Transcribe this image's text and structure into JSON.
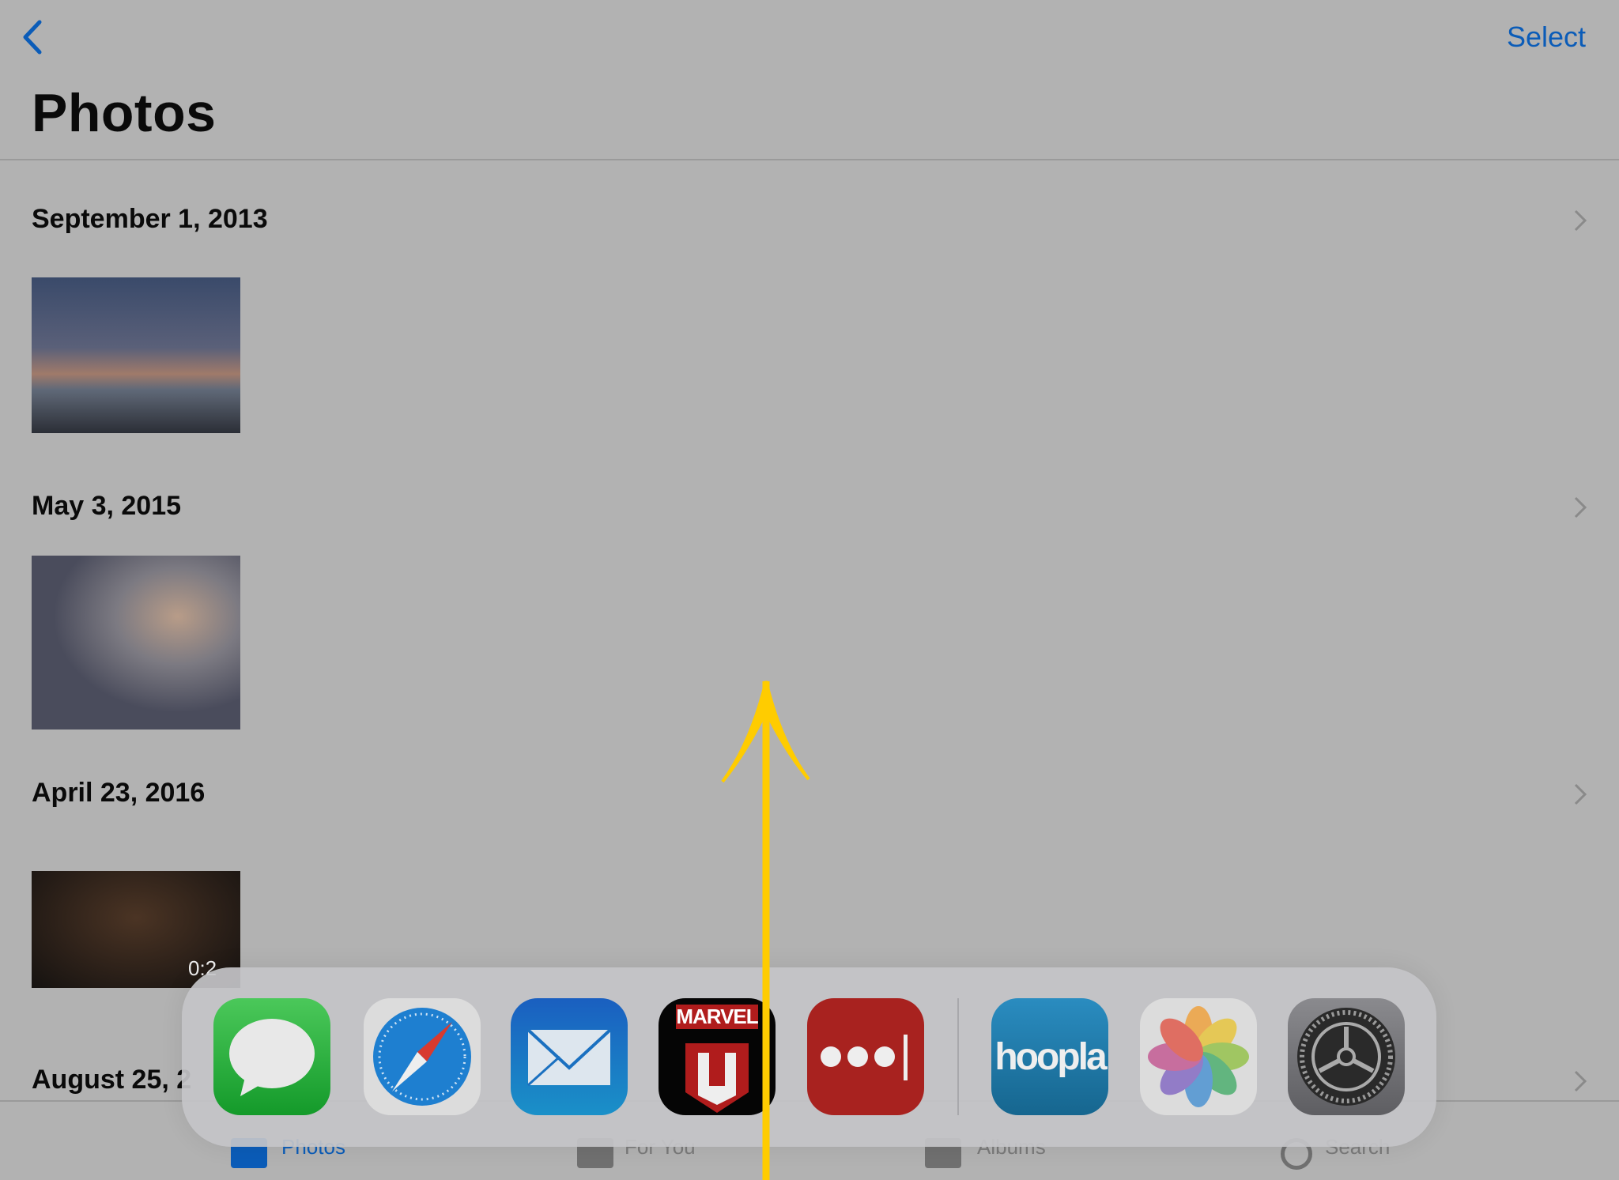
{
  "nav": {
    "back_icon": "chevron-left-icon",
    "select_label": "Select",
    "title": "Photos"
  },
  "sections": [
    {
      "date": "September 1, 2013"
    },
    {
      "date": "May 3, 2015"
    },
    {
      "date": "April 23, 2016",
      "video_duration": "0:2"
    },
    {
      "date": "August 25, 2"
    }
  ],
  "tabbar": {
    "tabs": [
      {
        "label": "Photos",
        "active": true
      },
      {
        "label": "For You"
      },
      {
        "label": "Albums"
      },
      {
        "label": "Search"
      }
    ]
  },
  "dock": {
    "apps": [
      "Messages",
      "Safari",
      "Mail",
      "Marvel Unlimited",
      "LastPass",
      "hoopla",
      "Photos",
      "Settings"
    ],
    "marvel_text": "MARVEL",
    "hoopla_text": "hoopla"
  },
  "colors": {
    "accent": "#0b5cb8",
    "arrow": "#ffcc00",
    "background": "#b2b2b2"
  }
}
